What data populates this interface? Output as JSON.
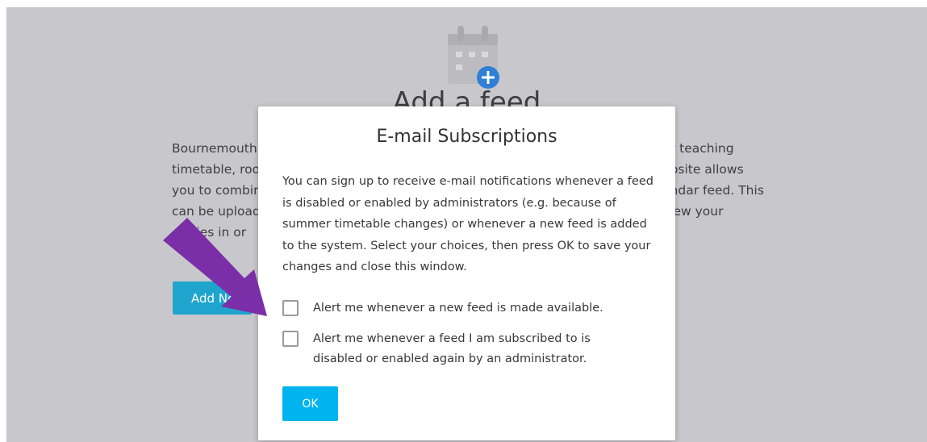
{
  "background": {
    "heading": "Add a feed",
    "text_left": [
      "Bournemouth",
      "timetable, roo",
      "you to combir",
      "can be upload",
      "ities in or"
    ],
    "text_right": [
      "ur teaching",
      "ebsite allows",
      "endar feed. This",
      "view your"
    ],
    "add_button_label": "Add Ne"
  },
  "modal": {
    "title": "E-mail Subscriptions",
    "body": "You can sign up to receive e-mail notifications whenever a feed is disabled or enabled by administrators (e.g. because of summer timetable changes) or whenever a new feed is added to the system. Select your choices, then press OK to save your changes and close this window.",
    "options": [
      {
        "label": "Alert me whenever a new feed is made available.",
        "checked": false
      },
      {
        "label": "Alert me whenever a feed I am subscribed to is disabled or enabled again by an administrator.",
        "checked": false
      }
    ],
    "ok_label": "OK"
  },
  "colors": {
    "overlay": "#c8c8cc",
    "ok_button": "#00b4f0",
    "calendar_icon_badge": "#2f7fd6",
    "arrow": "#7a2fa8"
  },
  "icons": [
    "calendar-add-icon",
    "plus-icon"
  ]
}
